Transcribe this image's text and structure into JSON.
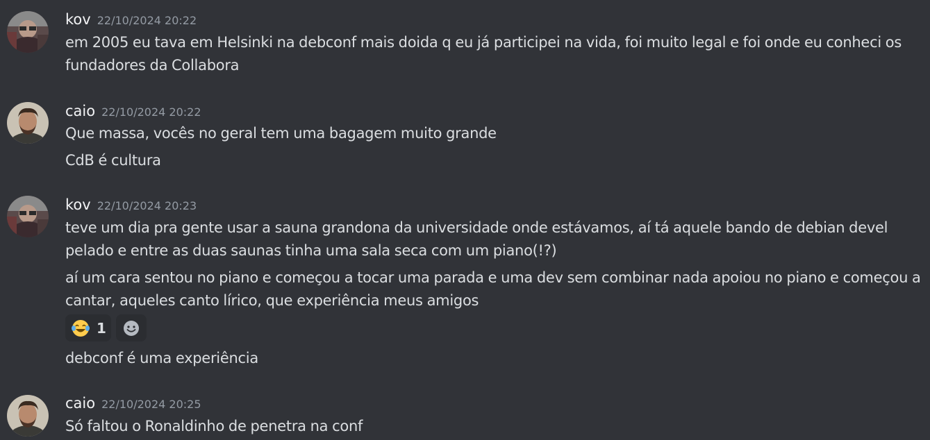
{
  "messages": [
    {
      "author": "kov",
      "timestamp": "22/10/2024 20:22",
      "lines": [
        "em 2005 eu tava em Helsinki na debconf mais doida q eu já participei na vida, foi muito legal e foi onde eu conheci os fundadores da Collabora"
      ]
    },
    {
      "author": "caio",
      "timestamp": "22/10/2024 20:22",
      "lines": [
        "Que massa, vocês no geral tem uma bagagem muito grande",
        "CdB é cultura"
      ]
    },
    {
      "author": "kov",
      "timestamp": "22/10/2024 20:23",
      "lines": [
        "teve um dia pra gente usar a sauna grandona da universidade onde estávamos, aí tá aquele bando de debian devel pelado e entre as duas saunas tinha uma sala seca com um piano(!?)",
        "aí um cara sentou no piano e começou a tocar uma parada e uma dev sem combinar nada apoiou no piano e começou a cantar, aqueles canto lírico, que experiência meus amigos",
        "debconf é uma experiência"
      ],
      "reaction": {
        "emoji": "face-with-tears-of-joy-icon",
        "count": "1"
      }
    },
    {
      "author": "caio",
      "timestamp": "22/10/2024 20:25",
      "lines": [
        "Só faltou o Ronaldinho de penetra na conf"
      ]
    }
  ],
  "colors": {
    "background": "#313338",
    "text": "#dbdee1",
    "username": "#f2f3f5",
    "timestamp": "#949ba4",
    "reaction_bg": "#2b2d31"
  }
}
